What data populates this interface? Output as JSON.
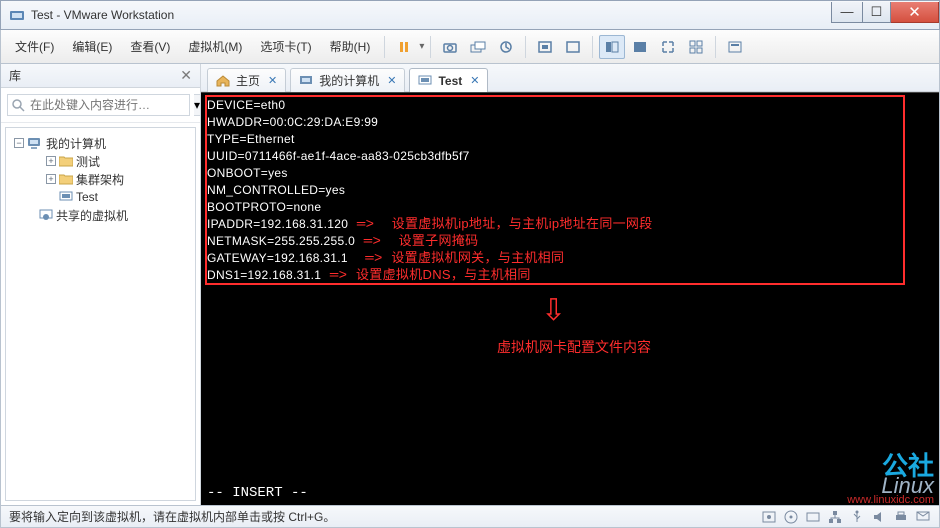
{
  "window": {
    "title": "Test - VMware Workstation"
  },
  "menubar": {
    "items": [
      "文件(F)",
      "编辑(E)",
      "查看(V)",
      "虚拟机(M)",
      "选项卡(T)",
      "帮助(H)"
    ]
  },
  "sidebar": {
    "title": "库",
    "search_placeholder": "在此处键入内容进行…",
    "tree": {
      "root": "我的计算机",
      "items": [
        "测试",
        "集群架构",
        "Test"
      ],
      "shared": "共享的虚拟机"
    }
  },
  "tabs": [
    {
      "label": "主页"
    },
    {
      "label": "我的计算机"
    },
    {
      "label": "Test"
    }
  ],
  "terminal": {
    "lines": [
      "DEVICE=eth0",
      "HWADDR=00:0C:29:DA:E9:99",
      "TYPE=Ethernet",
      "UUID=0711466f-ae1f-4ace-aa83-025cb3dfb5f7",
      "ONBOOT=yes",
      "NM_CONTROLLED=yes",
      "BOOTPROTO=none"
    ],
    "annotated": [
      {
        "text": "IPADDR=192.168.31.120",
        "note": "设置虚拟机ip地址，与主机ip地址在同一网段"
      },
      {
        "text": "NETMASK=255.255.255.0",
        "note": "设置子网掩码"
      },
      {
        "text": "GATEWAY=192.168.31.1",
        "note": "设置虚拟机网关，与主机相同"
      },
      {
        "text": "DNS1=192.168.31.1",
        "note": "设置虚拟机DNS，与主机相同"
      }
    ],
    "mode_line": "-- INSERT --",
    "summary_label": "虚拟机网卡配置文件内容"
  },
  "statusbar": {
    "text": "要将输入定向到该虚拟机，请在虚拟机内部单击或按 Ctrl+G。"
  },
  "watermark": {
    "l1": "公社",
    "l2": "Linux",
    "l3": "www.linuxidc.com"
  }
}
